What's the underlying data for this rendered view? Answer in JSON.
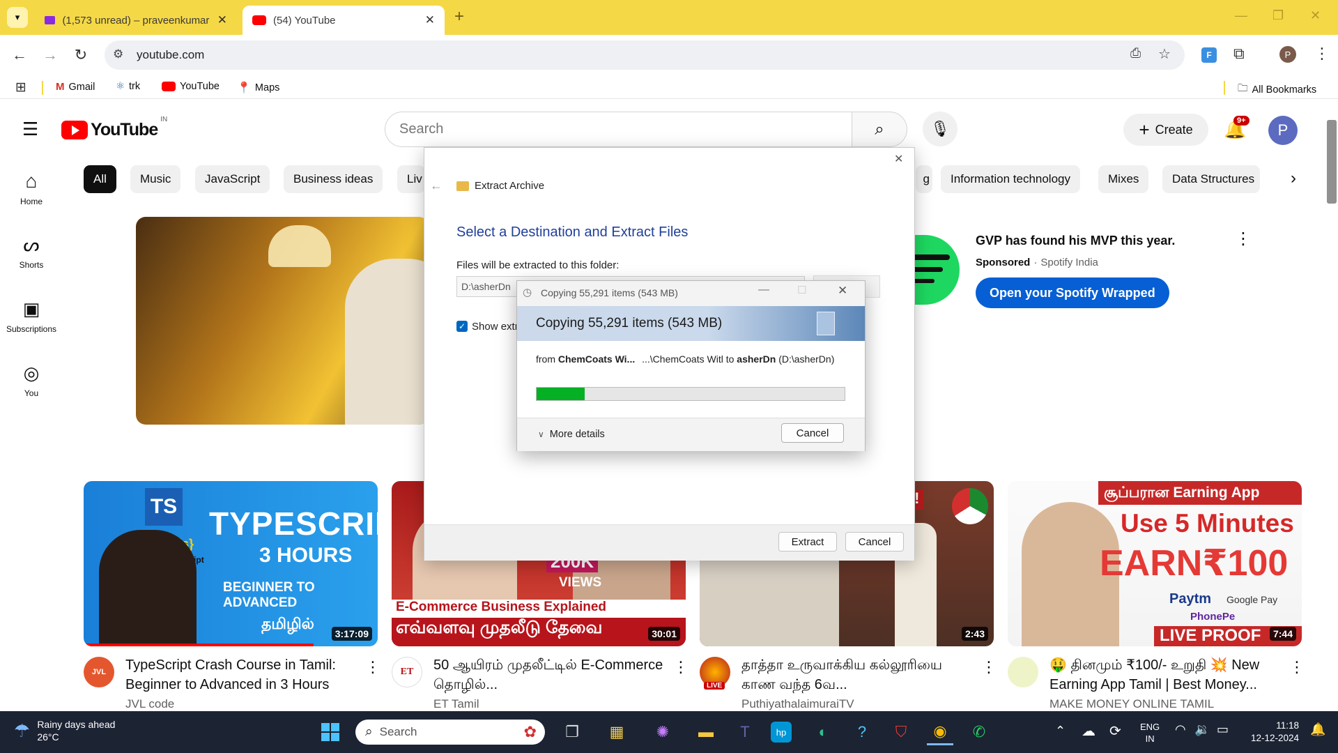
{
  "browser": {
    "tabs": [
      {
        "title": "(1,573 unread) – praveenkumar",
        "icon": "gmail-icon"
      },
      {
        "title": "(54) YouTube",
        "icon": "youtube-icon",
        "active": true
      }
    ],
    "url": "youtube.com",
    "profile_initial": "P",
    "bookmarks": [
      {
        "label": "Gmail",
        "icon": "gmail-icon"
      },
      {
        "label": "trk",
        "icon": "react-icon"
      },
      {
        "label": "YouTube",
        "icon": "youtube-icon"
      },
      {
        "label": "Maps",
        "icon": "maps-icon"
      }
    ],
    "all_bookmarks": "All Bookmarks"
  },
  "youtube": {
    "logo_text": "YouTube",
    "region": "IN",
    "search_placeholder": "Search",
    "create_label": "Create",
    "notif_count": "9+",
    "avatar_initial": "P",
    "sidebar": [
      {
        "label": "Home",
        "icon": "home-icon"
      },
      {
        "label": "Shorts",
        "icon": "shorts-icon"
      },
      {
        "label": "Subscriptions",
        "icon": "subscriptions-icon"
      },
      {
        "label": "You",
        "icon": "you-icon"
      }
    ],
    "chips_left": [
      "All",
      "Music",
      "JavaScript",
      "Business ideas",
      "Liv"
    ],
    "chips_right": [
      "g",
      "Information technology",
      "Mixes",
      "Data Structures"
    ],
    "ad": {
      "title": "GVP has found his MVP this year.",
      "sponsored": "Sponsored",
      "advertiser": "Spotify India",
      "cta": "Open your Spotify Wrapped"
    },
    "videos": [
      {
        "title": "TypeScript Crash Course in Tamil: Beginner to Advanced in 3 Hours",
        "channel": "JVL code",
        "duration": "3:17:09",
        "thumb_lines": [
          "TYPESCRIPT",
          "3 HOURS",
          "BEGINNER TO ADVANCED",
          "தமிழில்",
          "TS",
          "{.js}",
          "JavaScript"
        ]
      },
      {
        "title": "50 ஆயிரம் முதலீட்டில் E-Commerce தொழில்...",
        "channel": "ET Tamil",
        "duration": "30:01",
        "thumb_lines": [
          "200K",
          "VIEWS",
          "E-Commerce Business Explained",
          "எவ்வளவு முதலீடு தேவை",
          "ET"
        ]
      },
      {
        "title": "தாத்தா உருவாக்கிய கல்லூரியை காண வந்த 6வ...",
        "channel": "PuthiyathalaimuraiTV",
        "duration": "2:43",
        "thumb_lines": [
          "ந்தி!"
        ]
      },
      {
        "title": "🤑 தினமும் ₹100/- உறுதி 💥 New Earning App Tamil | Best Money...",
        "channel": "MAKE MONEY ONLINE TAMIL",
        "duration": "7:44",
        "thumb_lines": [
          "சூப்பரான Earning App",
          "Use 5 Minutes",
          "EARN₹100",
          "Paytm",
          "Google Pay",
          "PhonePe",
          "LIVE PROOF"
        ]
      }
    ],
    "live_badge": "LIVE"
  },
  "extract_dialog": {
    "window_title": "Extract Archive",
    "heading": "Select a Destination and Extract Files",
    "folder_label": "Files will be extracted to this folder:",
    "folder_value": "D:\\asherDn",
    "show_label": "Show extr",
    "extract_btn": "Extract",
    "cancel_btn": "Cancel"
  },
  "copy_dialog": {
    "window_title": "Copying 55,291 items (543 MB)",
    "banner": "Copying 55,291 items (543 MB)",
    "from_word": "from",
    "from_name": "ChemCoats Wi...",
    "path_mid": "...\\ChemCoats Witl",
    "to_word": "to",
    "to_name": "asherDn",
    "to_path": "(D:\\asherDn)",
    "progress": 0.155,
    "more_details": "More details",
    "cancel": "Cancel"
  },
  "taskbar": {
    "weather_title": "Rainy days ahead",
    "weather_temp": "26°C",
    "search_placeholder": "Search",
    "lang_line1": "ENG",
    "lang_line2": "IN",
    "time": "11:18",
    "date": "12-12-2024"
  }
}
